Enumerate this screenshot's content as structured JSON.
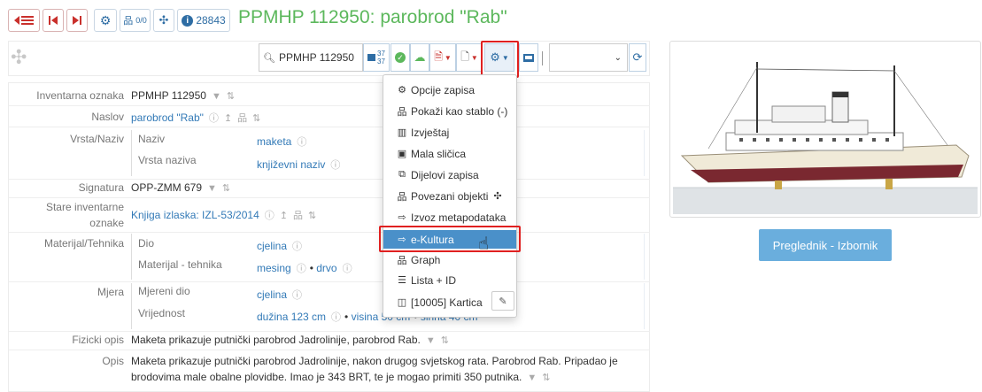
{
  "toolbar": {
    "count_label": "28843",
    "node_label": "0/0",
    "title": "PPMHP 112950: parobrod \"Rab\""
  },
  "subtoolbar": {
    "search_value": "PPMHP 112950",
    "counter_top": "37",
    "counter_bottom": "37",
    "select_value": ""
  },
  "record": {
    "rows": [
      {
        "label": "Inventarna oznaka",
        "value": "PPMHP 112950"
      },
      {
        "label": "Naslov",
        "value": "parobrod \"Rab\""
      },
      {
        "label": "Vrsta/Naziv",
        "subs": [
          {
            "label": "Naziv",
            "value": "maketa"
          },
          {
            "label": "Vrsta naziva",
            "value": "književni naziv"
          }
        ]
      },
      {
        "label": "Signatura",
        "value": "OPP-ZMM 679"
      },
      {
        "label_line1": "Stare inventarne",
        "label_line2": "oznake",
        "value": "Knjiga izlaska: IZL-53/2014"
      },
      {
        "label": "Materijal/Tehnika",
        "subs": [
          {
            "label": "Dio",
            "value": "cjelina"
          },
          {
            "label": "Materijal - tehnika",
            "value": "mesing",
            "value2": "drvo"
          }
        ]
      },
      {
        "label": "Mjera",
        "subs": [
          {
            "label": "Mjereni dio",
            "value": "cjelina"
          },
          {
            "label": "Vrijednost",
            "value": "dužina 123 cm",
            "value2": "visina 50 cm",
            "value3": "širina 40 cm"
          }
        ]
      },
      {
        "label": "Fizicki opis",
        "value": "Maketa prikazuje putnički parobrod Jadrolinije, parobrod Rab."
      },
      {
        "label": "Opis",
        "value_line1": "Maketa prikazuje putnički parobrod Jadrolinije, nakon drugog svjetskog rata. Parobrod Rab. Pripadao je",
        "value_line2": "brodovima male obalne plovidbe. Imao je 343 BRT, te je mogao primiti 350 putnika."
      }
    ]
  },
  "menu": {
    "items": [
      {
        "label": "Opcije zapisa",
        "icon": "cogs-icon"
      },
      {
        "label": "Pokaži kao stablo (-)",
        "icon": "sitemap-icon"
      },
      {
        "label": "Izvještaj",
        "icon": "bar-chart-icon"
      },
      {
        "label": "Mala sličica",
        "icon": "image-icon"
      },
      {
        "label": "Dijelovi zapisa",
        "icon": "copy-icon"
      },
      {
        "label": "Povezani objekti",
        "icon": "sitemap-icon"
      },
      {
        "label": "Izvoz metapodataka",
        "icon": "export-icon"
      },
      {
        "label": "e-Kultura",
        "icon": "export-icon"
      },
      {
        "label": "Graph",
        "icon": "sitemap-icon"
      },
      {
        "label": "Lista + ID",
        "icon": "list-icon"
      },
      {
        "label": "[10005] Kartica",
        "icon": "columns-icon"
      }
    ]
  },
  "viewer_button": "Preglednik - Izbornik",
  "colors": {
    "title_green": "#5cb85c",
    "link_blue": "#337ab7",
    "menu_active": "#4a90c9",
    "highlight_red": "#e02020",
    "viewer_button": "#6aaedd"
  }
}
